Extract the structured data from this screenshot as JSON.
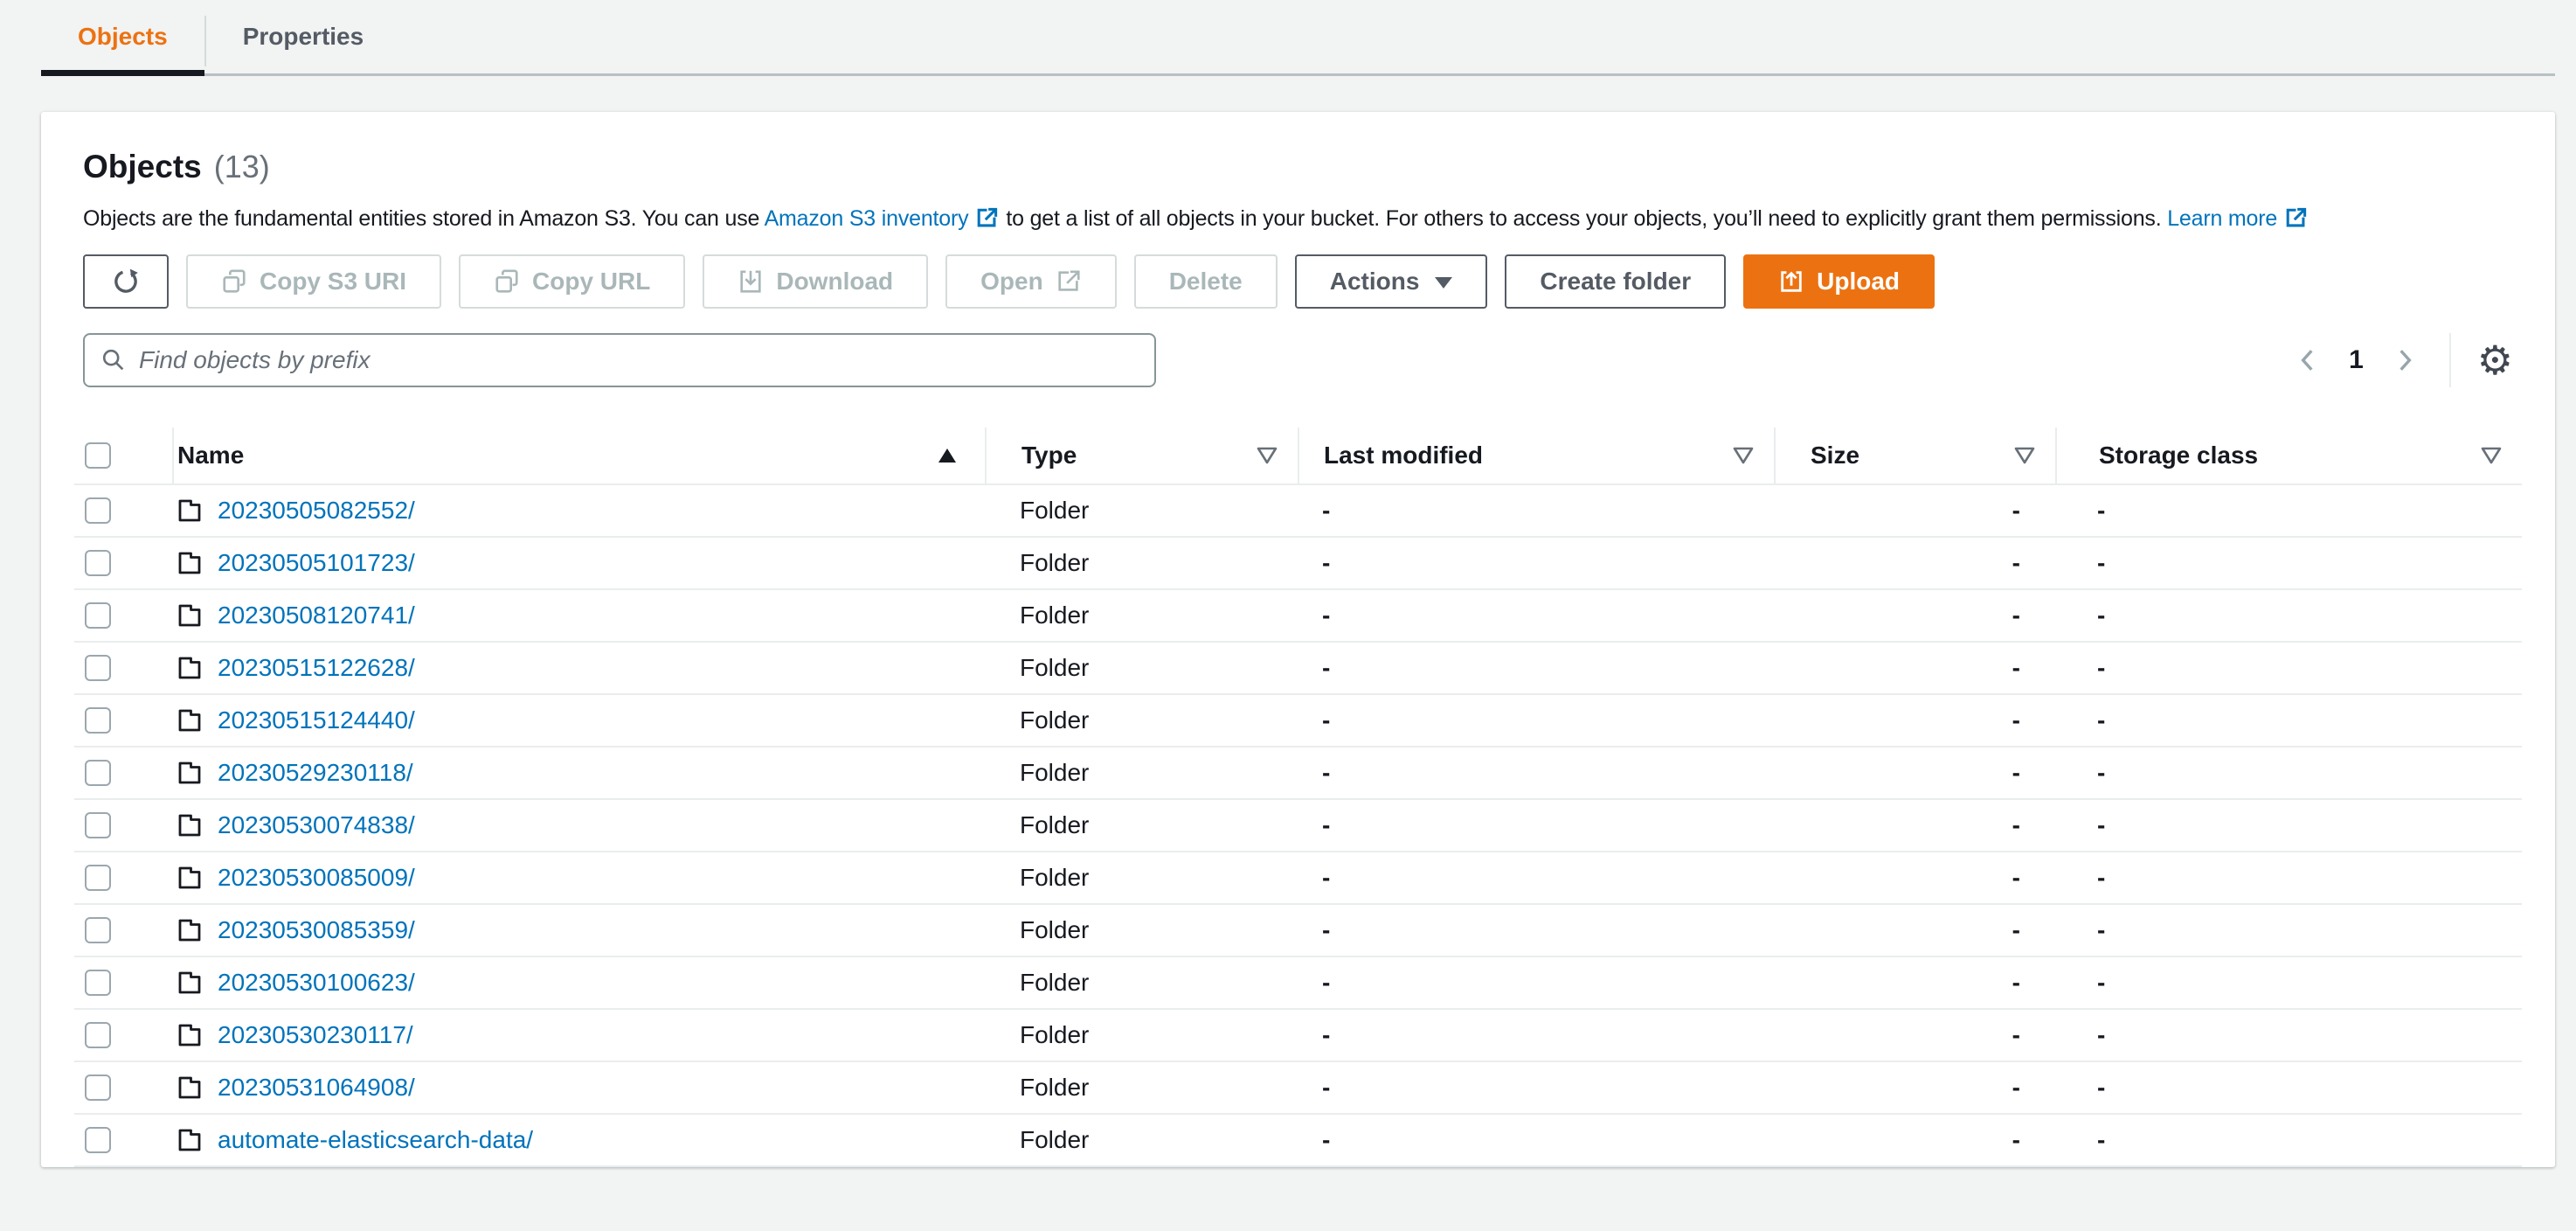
{
  "tabs": {
    "objects": "Objects",
    "properties": "Properties"
  },
  "header": {
    "title": "Objects",
    "count": "(13)"
  },
  "description": {
    "part1": "Objects are the fundamental entities stored in Amazon S3. You can use",
    "link1": "Amazon S3 inventory",
    "part2": "to get a list of all objects in your bucket. For others to access your objects, you’ll need to explicitly grant them permissions.",
    "link2": "Learn more"
  },
  "toolbar": {
    "copy_s3_uri": "Copy S3 URI",
    "copy_url": "Copy URL",
    "download": "Download",
    "open": "Open",
    "delete": "Delete",
    "actions": "Actions",
    "create_folder": "Create folder",
    "upload": "Upload"
  },
  "search": {
    "placeholder": "Find objects by prefix"
  },
  "pagination": {
    "current_page": "1"
  },
  "table": {
    "columns": [
      "Name",
      "Type",
      "Last modified",
      "Size",
      "Storage class"
    ],
    "sort": {
      "column": "Name",
      "direction": "ascending"
    },
    "rows": [
      {
        "name": "20230505082552/",
        "type": "Folder",
        "last_modified": "-",
        "size": "-",
        "storage_class": "-"
      },
      {
        "name": "20230505101723/",
        "type": "Folder",
        "last_modified": "-",
        "size": "-",
        "storage_class": "-"
      },
      {
        "name": "20230508120741/",
        "type": "Folder",
        "last_modified": "-",
        "size": "-",
        "storage_class": "-"
      },
      {
        "name": "20230515122628/",
        "type": "Folder",
        "last_modified": "-",
        "size": "-",
        "storage_class": "-"
      },
      {
        "name": "20230515124440/",
        "type": "Folder",
        "last_modified": "-",
        "size": "-",
        "storage_class": "-"
      },
      {
        "name": "20230529230118/",
        "type": "Folder",
        "last_modified": "-",
        "size": "-",
        "storage_class": "-"
      },
      {
        "name": "20230530074838/",
        "type": "Folder",
        "last_modified": "-",
        "size": "-",
        "storage_class": "-"
      },
      {
        "name": "20230530085009/",
        "type": "Folder",
        "last_modified": "-",
        "size": "-",
        "storage_class": "-"
      },
      {
        "name": "20230530085359/",
        "type": "Folder",
        "last_modified": "-",
        "size": "-",
        "storage_class": "-"
      },
      {
        "name": "20230530100623/",
        "type": "Folder",
        "last_modified": "-",
        "size": "-",
        "storage_class": "-"
      },
      {
        "name": "20230530230117/",
        "type": "Folder",
        "last_modified": "-",
        "size": "-",
        "storage_class": "-"
      },
      {
        "name": "20230531064908/",
        "type": "Folder",
        "last_modified": "-",
        "size": "-",
        "storage_class": "-"
      },
      {
        "name": "automate-elasticsearch-data/",
        "type": "Folder",
        "last_modified": "-",
        "size": "-",
        "storage_class": "-"
      }
    ]
  },
  "colors": {
    "accent_orange": "#EC7211",
    "link_blue": "#0073BB",
    "tab_underline": "#16191F",
    "disabled_text": "#AAB7B8"
  }
}
